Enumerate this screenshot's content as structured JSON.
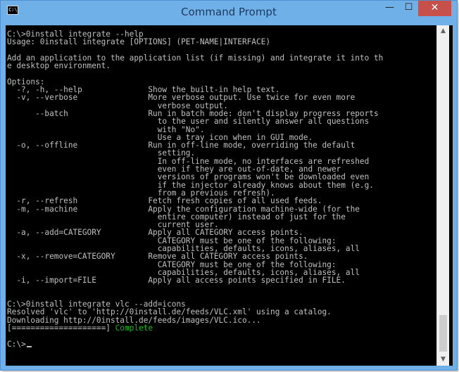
{
  "window": {
    "title": "Command Prompt",
    "icon_text": "C:\\.",
    "minimize_glyph": "—",
    "maximize_glyph": "☐",
    "close_glyph": "✕"
  },
  "console": {
    "lines": [
      "C:\\>0install integrate --help",
      "Usage: 0install integrate [OPTIONS] (PET-NAME|INTERFACE)",
      "",
      "Add an application to the application list (if missing) and integrate it into th",
      "e desktop environment.",
      "",
      "Options:",
      "  -?, -h, --help              Show the built-in help text.",
      "  -v, --verbose               More verbose output. Use twice for even more",
      "                                verbose output.",
      "      --batch                 Run in batch mode: don't display progress reports",
      "                                to the user and silently answer all questions",
      "                                with \"No\".",
      "                                Use a tray icon when in GUI mode.",
      "  -o, --offline               Run in off-line mode, overriding the default",
      "                                setting.",
      "                                In off-line mode, no interfaces are refreshed",
      "                                even if they are out-of-date, and newer",
      "                                versions of programs won't be downloaded even",
      "                                if the injector already knows about them (e.g.",
      "                                from a previous refresh).",
      "  -r, --refresh               Fetch fresh copies of all used feeds.",
      "  -m, --machine               Apply the configuration machine-wide (for the",
      "                                entire computer) instead of just for the",
      "                                current user.",
      "  -a, --add=CATEGORY          Apply all CATEGORY access points.",
      "                                CATEGORY must be one of the following:",
      "                                capabilities, defaults, icons, aliases, all",
      "  -x, --remove=CATEGORY       Remove all CATEGORY access points.",
      "                                CATEGORY must be one of the following:",
      "                                capabilities, defaults, icons, aliases, all",
      "  -i, --import=FILE           Apply all access points specified in FILE.",
      "",
      "",
      "C:\\>0install integrate vlc --add=icons",
      "Resolved 'vlc' to 'http://0install.de/feeds/VLC.xml' using a catalog.",
      "Downloading http://0install.de/feeds/images/VLC.ico...",
      "[====================] ",
      "",
      "C:\\>"
    ],
    "status_word": "Complete",
    "status_color": "#00c400",
    "text_color": "#c0c0c0"
  },
  "scrollbar": {
    "up_glyph": "▲",
    "down_glyph": "▼"
  }
}
